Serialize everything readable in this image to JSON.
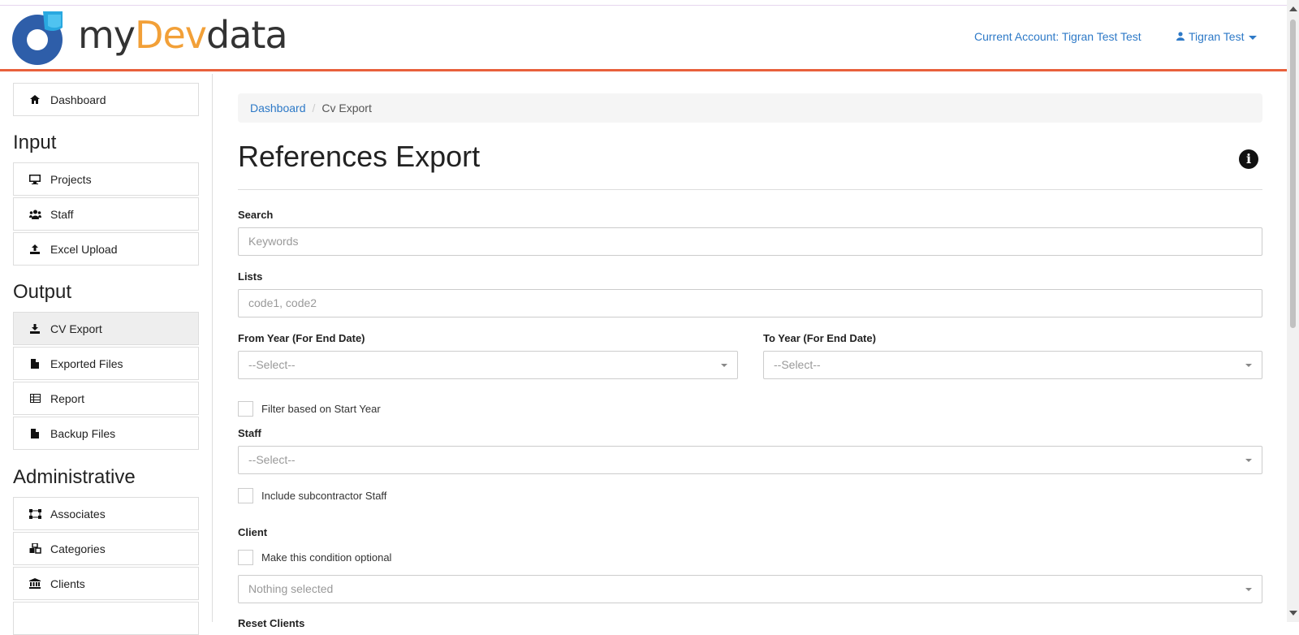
{
  "header": {
    "logo_prefix": "my",
    "logo_dev": "Dev",
    "logo_suffix": "data",
    "current_account": "Current Account: Tigran Test Test",
    "user_name": "Tigran Test"
  },
  "sidebar": {
    "dashboard": "Dashboard",
    "input_heading": "Input",
    "input_items": [
      "Projects",
      "Staff",
      "Excel Upload"
    ],
    "output_heading": "Output",
    "output_items": [
      "CV Export",
      "Exported Files",
      "Report",
      "Backup Files"
    ],
    "admin_heading": "Administrative",
    "admin_items": [
      "Associates",
      "Categories",
      "Clients"
    ]
  },
  "breadcrumb": {
    "home": "Dashboard",
    "separator": "/",
    "current": "Cv Export"
  },
  "page": {
    "title": "References Export",
    "search_label": "Search",
    "search_placeholder": "Keywords",
    "lists_label": "Lists",
    "lists_placeholder": "code1, code2",
    "from_year_label": "From Year (For End Date)",
    "from_year_value": "--Select--",
    "to_year_label": "To Year (For End Date)",
    "to_year_value": "--Select--",
    "filter_start_year": "Filter based on Start Year",
    "staff_label": "Staff",
    "staff_value": "--Select--",
    "include_subcontractor": "Include subcontractor Staff",
    "client_label": "Client",
    "client_optional": "Make this condition optional",
    "client_value": "Nothing selected",
    "reset_clients_label": "Reset Clients"
  },
  "colors": {
    "accent": "#e8603c",
    "link": "#2d79c7",
    "logo_dev": "#f2a038",
    "logo_mark": "#2e5ea9"
  }
}
